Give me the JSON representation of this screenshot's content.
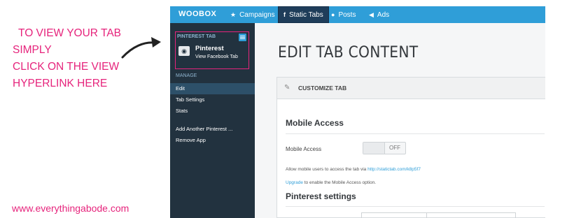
{
  "annotation": {
    "lines": [
      "TO VIEW YOUR TAB",
      "SIMPLY",
      "CLICK ON THE VIEW",
      "HYPERLINK HERE"
    ],
    "website": "www.everythingabode.com",
    "color": "#e6247c"
  },
  "app": {
    "logo": "WOOBOX",
    "nav": [
      {
        "label": "Campaigns",
        "icon": "star-icon"
      },
      {
        "label": "Static Tabs",
        "icon": "facebook-icon"
      },
      {
        "label": "Posts",
        "icon": "chat-icon"
      },
      {
        "label": "Ads",
        "icon": "megaphone-icon"
      }
    ],
    "accent_color": "#2f9ed8",
    "sidebar": {
      "tab_header": "PINTEREST TAB",
      "tab_name": "Pinterest",
      "tab_link": "View Facebook Tab",
      "manage_label": "MANAGE",
      "items": [
        "Edit",
        "Tab Settings",
        "Stats",
        "Add Another Pinterest ...",
        "Remove App"
      ],
      "active_item": "Edit"
    },
    "content": {
      "page_title": "EDIT TAB CONTENT",
      "panel_header": "CUSTOMIZE TAB",
      "mobile_section_title": "Mobile Access",
      "mobile_row_label": "Mobile Access",
      "toggle_state": "OFF",
      "help_text_prefix": "Allow mobile users to access the tab via",
      "help_link": "http://statictab.com/k8p5f7",
      "upgrade_link": "Upgrade",
      "upgrade_text": "to enable the Mobile Access option.",
      "pinterest_section_title": "Pinterest settings"
    }
  }
}
